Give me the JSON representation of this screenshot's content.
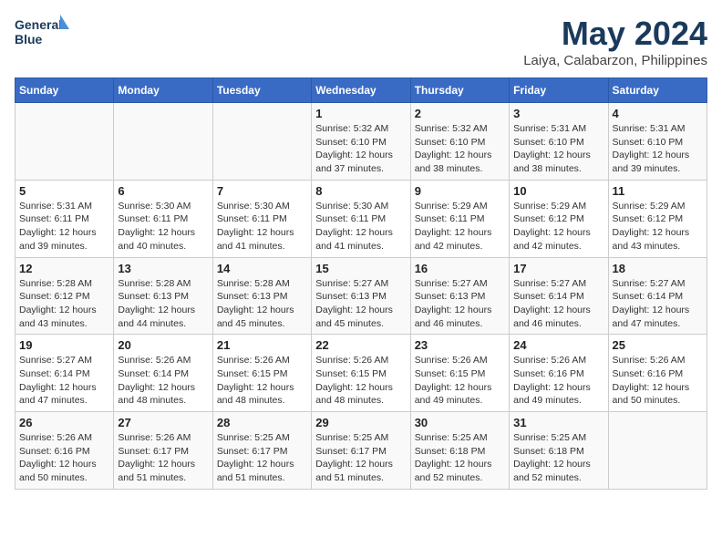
{
  "logo": {
    "line1": "General",
    "line2": "Blue"
  },
  "title": "May 2024",
  "subtitle": "Laiya, Calabarzon, Philippines",
  "days_header": [
    "Sunday",
    "Monday",
    "Tuesday",
    "Wednesday",
    "Thursday",
    "Friday",
    "Saturday"
  ],
  "weeks": [
    [
      {
        "day": "",
        "info": ""
      },
      {
        "day": "",
        "info": ""
      },
      {
        "day": "",
        "info": ""
      },
      {
        "day": "1",
        "info": "Sunrise: 5:32 AM\nSunset: 6:10 PM\nDaylight: 12 hours\nand 37 minutes."
      },
      {
        "day": "2",
        "info": "Sunrise: 5:32 AM\nSunset: 6:10 PM\nDaylight: 12 hours\nand 38 minutes."
      },
      {
        "day": "3",
        "info": "Sunrise: 5:31 AM\nSunset: 6:10 PM\nDaylight: 12 hours\nand 38 minutes."
      },
      {
        "day": "4",
        "info": "Sunrise: 5:31 AM\nSunset: 6:10 PM\nDaylight: 12 hours\nand 39 minutes."
      }
    ],
    [
      {
        "day": "5",
        "info": "Sunrise: 5:31 AM\nSunset: 6:11 PM\nDaylight: 12 hours\nand 39 minutes."
      },
      {
        "day": "6",
        "info": "Sunrise: 5:30 AM\nSunset: 6:11 PM\nDaylight: 12 hours\nand 40 minutes."
      },
      {
        "day": "7",
        "info": "Sunrise: 5:30 AM\nSunset: 6:11 PM\nDaylight: 12 hours\nand 41 minutes."
      },
      {
        "day": "8",
        "info": "Sunrise: 5:30 AM\nSunset: 6:11 PM\nDaylight: 12 hours\nand 41 minutes."
      },
      {
        "day": "9",
        "info": "Sunrise: 5:29 AM\nSunset: 6:11 PM\nDaylight: 12 hours\nand 42 minutes."
      },
      {
        "day": "10",
        "info": "Sunrise: 5:29 AM\nSunset: 6:12 PM\nDaylight: 12 hours\nand 42 minutes."
      },
      {
        "day": "11",
        "info": "Sunrise: 5:29 AM\nSunset: 6:12 PM\nDaylight: 12 hours\nand 43 minutes."
      }
    ],
    [
      {
        "day": "12",
        "info": "Sunrise: 5:28 AM\nSunset: 6:12 PM\nDaylight: 12 hours\nand 43 minutes."
      },
      {
        "day": "13",
        "info": "Sunrise: 5:28 AM\nSunset: 6:13 PM\nDaylight: 12 hours\nand 44 minutes."
      },
      {
        "day": "14",
        "info": "Sunrise: 5:28 AM\nSunset: 6:13 PM\nDaylight: 12 hours\nand 45 minutes."
      },
      {
        "day": "15",
        "info": "Sunrise: 5:27 AM\nSunset: 6:13 PM\nDaylight: 12 hours\nand 45 minutes."
      },
      {
        "day": "16",
        "info": "Sunrise: 5:27 AM\nSunset: 6:13 PM\nDaylight: 12 hours\nand 46 minutes."
      },
      {
        "day": "17",
        "info": "Sunrise: 5:27 AM\nSunset: 6:14 PM\nDaylight: 12 hours\nand 46 minutes."
      },
      {
        "day": "18",
        "info": "Sunrise: 5:27 AM\nSunset: 6:14 PM\nDaylight: 12 hours\nand 47 minutes."
      }
    ],
    [
      {
        "day": "19",
        "info": "Sunrise: 5:27 AM\nSunset: 6:14 PM\nDaylight: 12 hours\nand 47 minutes."
      },
      {
        "day": "20",
        "info": "Sunrise: 5:26 AM\nSunset: 6:14 PM\nDaylight: 12 hours\nand 48 minutes."
      },
      {
        "day": "21",
        "info": "Sunrise: 5:26 AM\nSunset: 6:15 PM\nDaylight: 12 hours\nand 48 minutes."
      },
      {
        "day": "22",
        "info": "Sunrise: 5:26 AM\nSunset: 6:15 PM\nDaylight: 12 hours\nand 48 minutes."
      },
      {
        "day": "23",
        "info": "Sunrise: 5:26 AM\nSunset: 6:15 PM\nDaylight: 12 hours\nand 49 minutes."
      },
      {
        "day": "24",
        "info": "Sunrise: 5:26 AM\nSunset: 6:16 PM\nDaylight: 12 hours\nand 49 minutes."
      },
      {
        "day": "25",
        "info": "Sunrise: 5:26 AM\nSunset: 6:16 PM\nDaylight: 12 hours\nand 50 minutes."
      }
    ],
    [
      {
        "day": "26",
        "info": "Sunrise: 5:26 AM\nSunset: 6:16 PM\nDaylight: 12 hours\nand 50 minutes."
      },
      {
        "day": "27",
        "info": "Sunrise: 5:26 AM\nSunset: 6:17 PM\nDaylight: 12 hours\nand 51 minutes."
      },
      {
        "day": "28",
        "info": "Sunrise: 5:25 AM\nSunset: 6:17 PM\nDaylight: 12 hours\nand 51 minutes."
      },
      {
        "day": "29",
        "info": "Sunrise: 5:25 AM\nSunset: 6:17 PM\nDaylight: 12 hours\nand 51 minutes."
      },
      {
        "day": "30",
        "info": "Sunrise: 5:25 AM\nSunset: 6:18 PM\nDaylight: 12 hours\nand 52 minutes."
      },
      {
        "day": "31",
        "info": "Sunrise: 5:25 AM\nSunset: 6:18 PM\nDaylight: 12 hours\nand 52 minutes."
      },
      {
        "day": "",
        "info": ""
      }
    ]
  ]
}
